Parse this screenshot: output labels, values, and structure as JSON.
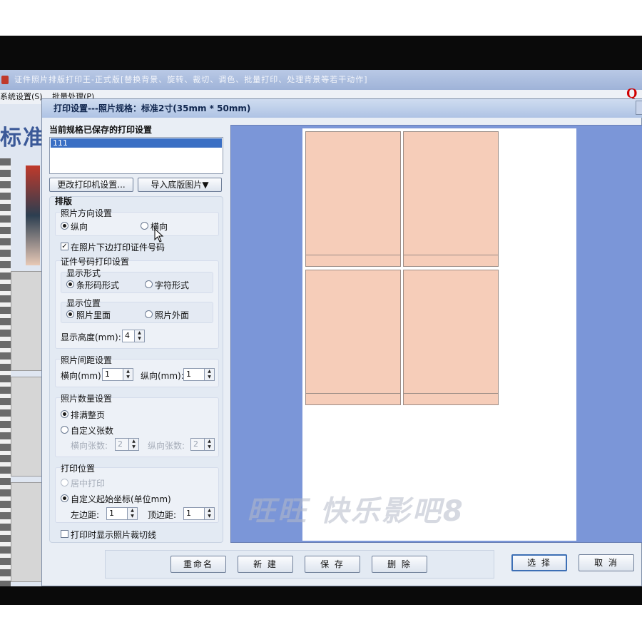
{
  "app": {
    "title": "证件照片排版打印王-正式版[替换背景、旋转、裁切、调色、批量打印、处理背景等若干动作]",
    "menu": [
      "系统设置(S)",
      "批量处理(P)"
    ],
    "brand_mark": "Q",
    "big_label": "标准"
  },
  "dialog": {
    "title": "打印设置---照片规格：标准2寸(35mm * 50mm)",
    "saved_settings": {
      "heading": "当前规格已保存的打印设置",
      "items": [
        "111"
      ]
    },
    "buttons": {
      "change_printer": "更改打印机设置...",
      "import_template": "导入底版图片▼"
    },
    "layout": {
      "heading": "排版",
      "orientation": {
        "title": "照片方向设置",
        "portrait": "纵向",
        "landscape": "横向",
        "selected": "纵向"
      },
      "print_id_number": {
        "label": "在照片下边打印证件号码",
        "checked": true
      },
      "id_number_settings": {
        "title": "证件号码打印设置",
        "display_form": {
          "title": "显示形式",
          "barcode": "条形码形式",
          "text": "字符形式",
          "selected": "条形码形式"
        },
        "display_position": {
          "title": "显示位置",
          "inside": "照片里面",
          "outside": "照片外面",
          "selected": "照片里面"
        },
        "height_label": "显示高度(mm):",
        "height_value": "4"
      },
      "spacing": {
        "title": "照片间距设置",
        "horizontal_label": "横向(mm):",
        "horizontal_value": "1",
        "vertical_label": "纵向(mm):",
        "vertical_value": "1"
      },
      "count": {
        "title": "照片数量设置",
        "fill_page": "排满整页",
        "custom": "自定义张数",
        "selected": "排满整页",
        "h_count_label": "横向张数:",
        "h_count_value": "2",
        "v_count_label": "纵向张数:",
        "v_count_value": "2"
      },
      "position": {
        "title": "打印位置",
        "center": "居中打印",
        "custom": "自定义起始坐标(单位mm)",
        "selected": "自定义起始坐标(单位mm)",
        "left_label": "左边距:",
        "left_value": "1",
        "top_label": "顶边距:",
        "top_value": "1"
      },
      "show_cut_lines": {
        "label": "打印时显示照片裁切线",
        "checked": false
      }
    },
    "preview": {
      "photo_count": 4,
      "watermark": "旺旺 快乐影吧8"
    },
    "footer": {
      "rename": "重命名",
      "new": "新 建",
      "save": "保 存",
      "delete": "删 除",
      "select": "选 择",
      "cancel": "取 消"
    }
  },
  "colors": {
    "preview_bg": "#7b96d8",
    "photo_fill": "#f6cdb9",
    "selection": "#3a6fc4"
  }
}
